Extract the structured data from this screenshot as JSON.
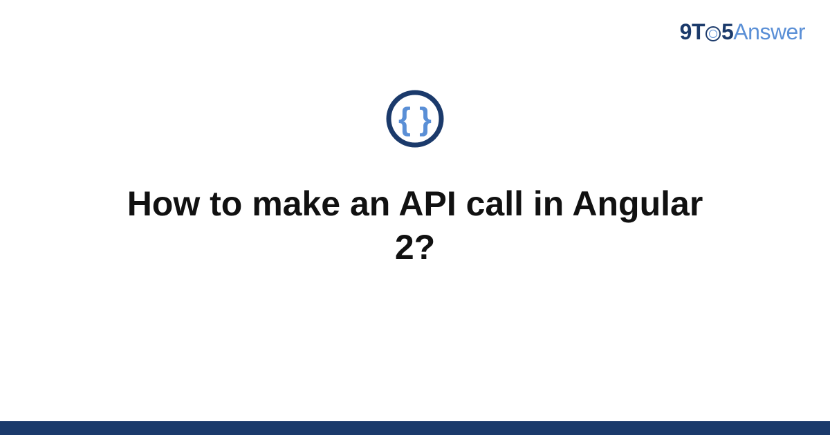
{
  "brand": {
    "part1": "9T",
    "part2": "5",
    "part3": "Answer"
  },
  "badge": {
    "left_brace": "{",
    "right_brace": "}"
  },
  "title": "How to make an API call in Angular 2?",
  "colors": {
    "brand_dark": "#1b3a6b",
    "brand_light": "#5a8fd6"
  }
}
